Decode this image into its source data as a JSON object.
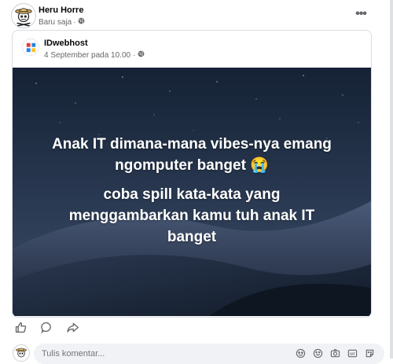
{
  "post": {
    "author": "Heru Horre",
    "time": "Baru saja",
    "separator": "·",
    "more_label": "•••"
  },
  "shared": {
    "page_name": "IDwebhost",
    "date": "4 September pada 10.00",
    "separator": "·",
    "line1": "Anak IT dimana-mana vibes-nya emang",
    "line2": "ngomputer banget 😭",
    "line3": "coba spill kata-kata yang",
    "line4": "menggambarkan kamu tuh anak IT",
    "line5": "banget"
  },
  "actions": [
    "like-icon",
    "comment-icon",
    "share-icon"
  ],
  "comment": {
    "placeholder": "Tulis komentar...",
    "icons": [
      "sticker-icon",
      "emoji-icon",
      "camera-icon",
      "gif-icon",
      "avatar-sticker-icon"
    ]
  },
  "colors": {
    "author": "#050505",
    "meta": "#65676b",
    "comment_bg": "#f0f2f5",
    "image_sky": "#1d2a3b"
  }
}
